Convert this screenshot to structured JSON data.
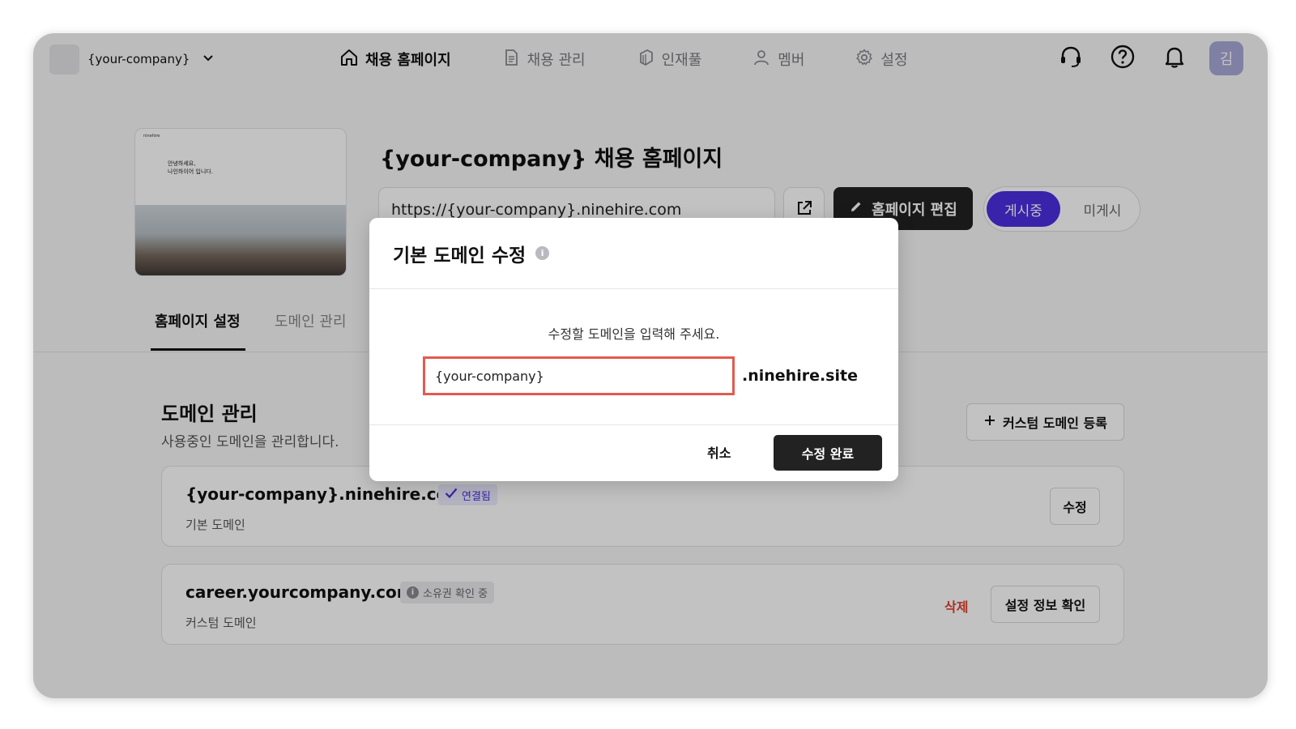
{
  "header": {
    "company_name": "{your-company}",
    "nav": [
      {
        "label": "채용 홈페이지",
        "icon": "home-icon",
        "active": true
      },
      {
        "label": "채용 관리",
        "icon": "document-icon",
        "active": false
      },
      {
        "label": "인재풀",
        "icon": "pool-icon",
        "active": false
      },
      {
        "label": "멤버",
        "icon": "person-icon",
        "active": false
      },
      {
        "label": "설정",
        "icon": "gear-icon",
        "active": false
      }
    ],
    "icons": [
      "headset-icon",
      "help-icon",
      "bell-icon"
    ],
    "avatar_initial": "김"
  },
  "thumbnail": {
    "brand": "ninehire",
    "heading_line1": "안녕하세요,",
    "heading_line2": "나인하이어 입니다."
  },
  "homepage": {
    "title": "{your-company} 채용 홈페이지",
    "url": "https://{your-company}.ninehire.com",
    "edit_label": "홈페이지 편집",
    "toggle_on": "게시중",
    "toggle_off": "미게시"
  },
  "tabs": [
    {
      "label": "홈페이지 설정",
      "active": true
    },
    {
      "label": "도메인 관리",
      "active": false
    }
  ],
  "domains": {
    "title": "도메인 관리",
    "description": "사용중인 도메인을 관리합니다.",
    "add_custom_label": "커스텀 도메인 등록",
    "items": [
      {
        "domain": "{your-company}.ninehire.com",
        "badge": "연결됨",
        "type": "기본 도메인",
        "button": "수정"
      },
      {
        "domain": "career.yourcompany.com",
        "badge": "소유권 확인 중",
        "type": "커스텀 도메인",
        "delete": "삭제",
        "button": "설정 정보 확인"
      }
    ]
  },
  "modal": {
    "title": "기본 도메인 수정",
    "description": "수정할 도메인을 입력해 주세요.",
    "input_value": "{your-company}",
    "suffix": ".ninehire.site",
    "cancel": "취소",
    "confirm": "수정 완료"
  },
  "colors": {
    "accent": "#4a2fe0",
    "danger": "#e0402f",
    "input_error_border": "#e25b4f",
    "dark_button": "#222222"
  }
}
